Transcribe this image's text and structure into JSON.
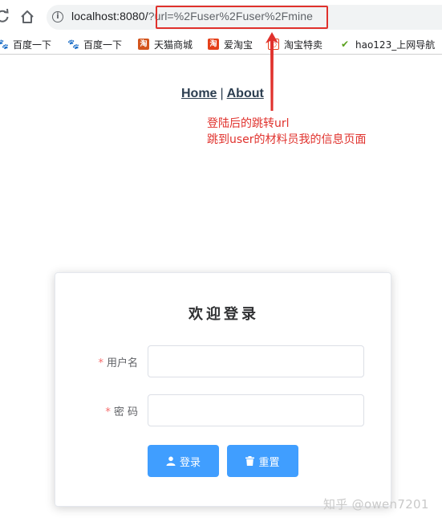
{
  "browser": {
    "url_host": "localhost:8080/",
    "url_rest": "?url=%2Fuser%2Fuser%2Fmine",
    "bookmarks": [
      {
        "label": "百度一下",
        "icon": "baidu-paw-icon"
      },
      {
        "label": "百度一下",
        "icon": "baidu-paw-icon"
      },
      {
        "label": "天猫商城",
        "icon": "tmall-icon"
      },
      {
        "label": "爱淘宝",
        "icon": "taobao-icon"
      },
      {
        "label": "淘宝特卖",
        "icon": "taobao-sale-icon"
      },
      {
        "label": "hao123_上网导航",
        "icon": "hao123-icon"
      }
    ]
  },
  "nav": {
    "home": "Home",
    "separator": "|",
    "about": "About"
  },
  "annotation": {
    "line1": "登陆后的跳转url",
    "line2": "跳到user的材料员我的信息页面",
    "color": "#e0312c"
  },
  "login": {
    "title": "欢迎登录",
    "username_label": "用户名",
    "password_label": "密 码",
    "required_mark": "*",
    "username_value": "",
    "password_value": "",
    "login_button": "登录",
    "reset_button": "重置",
    "accent": "#409eff"
  },
  "watermark": "知乎 @owen7201"
}
